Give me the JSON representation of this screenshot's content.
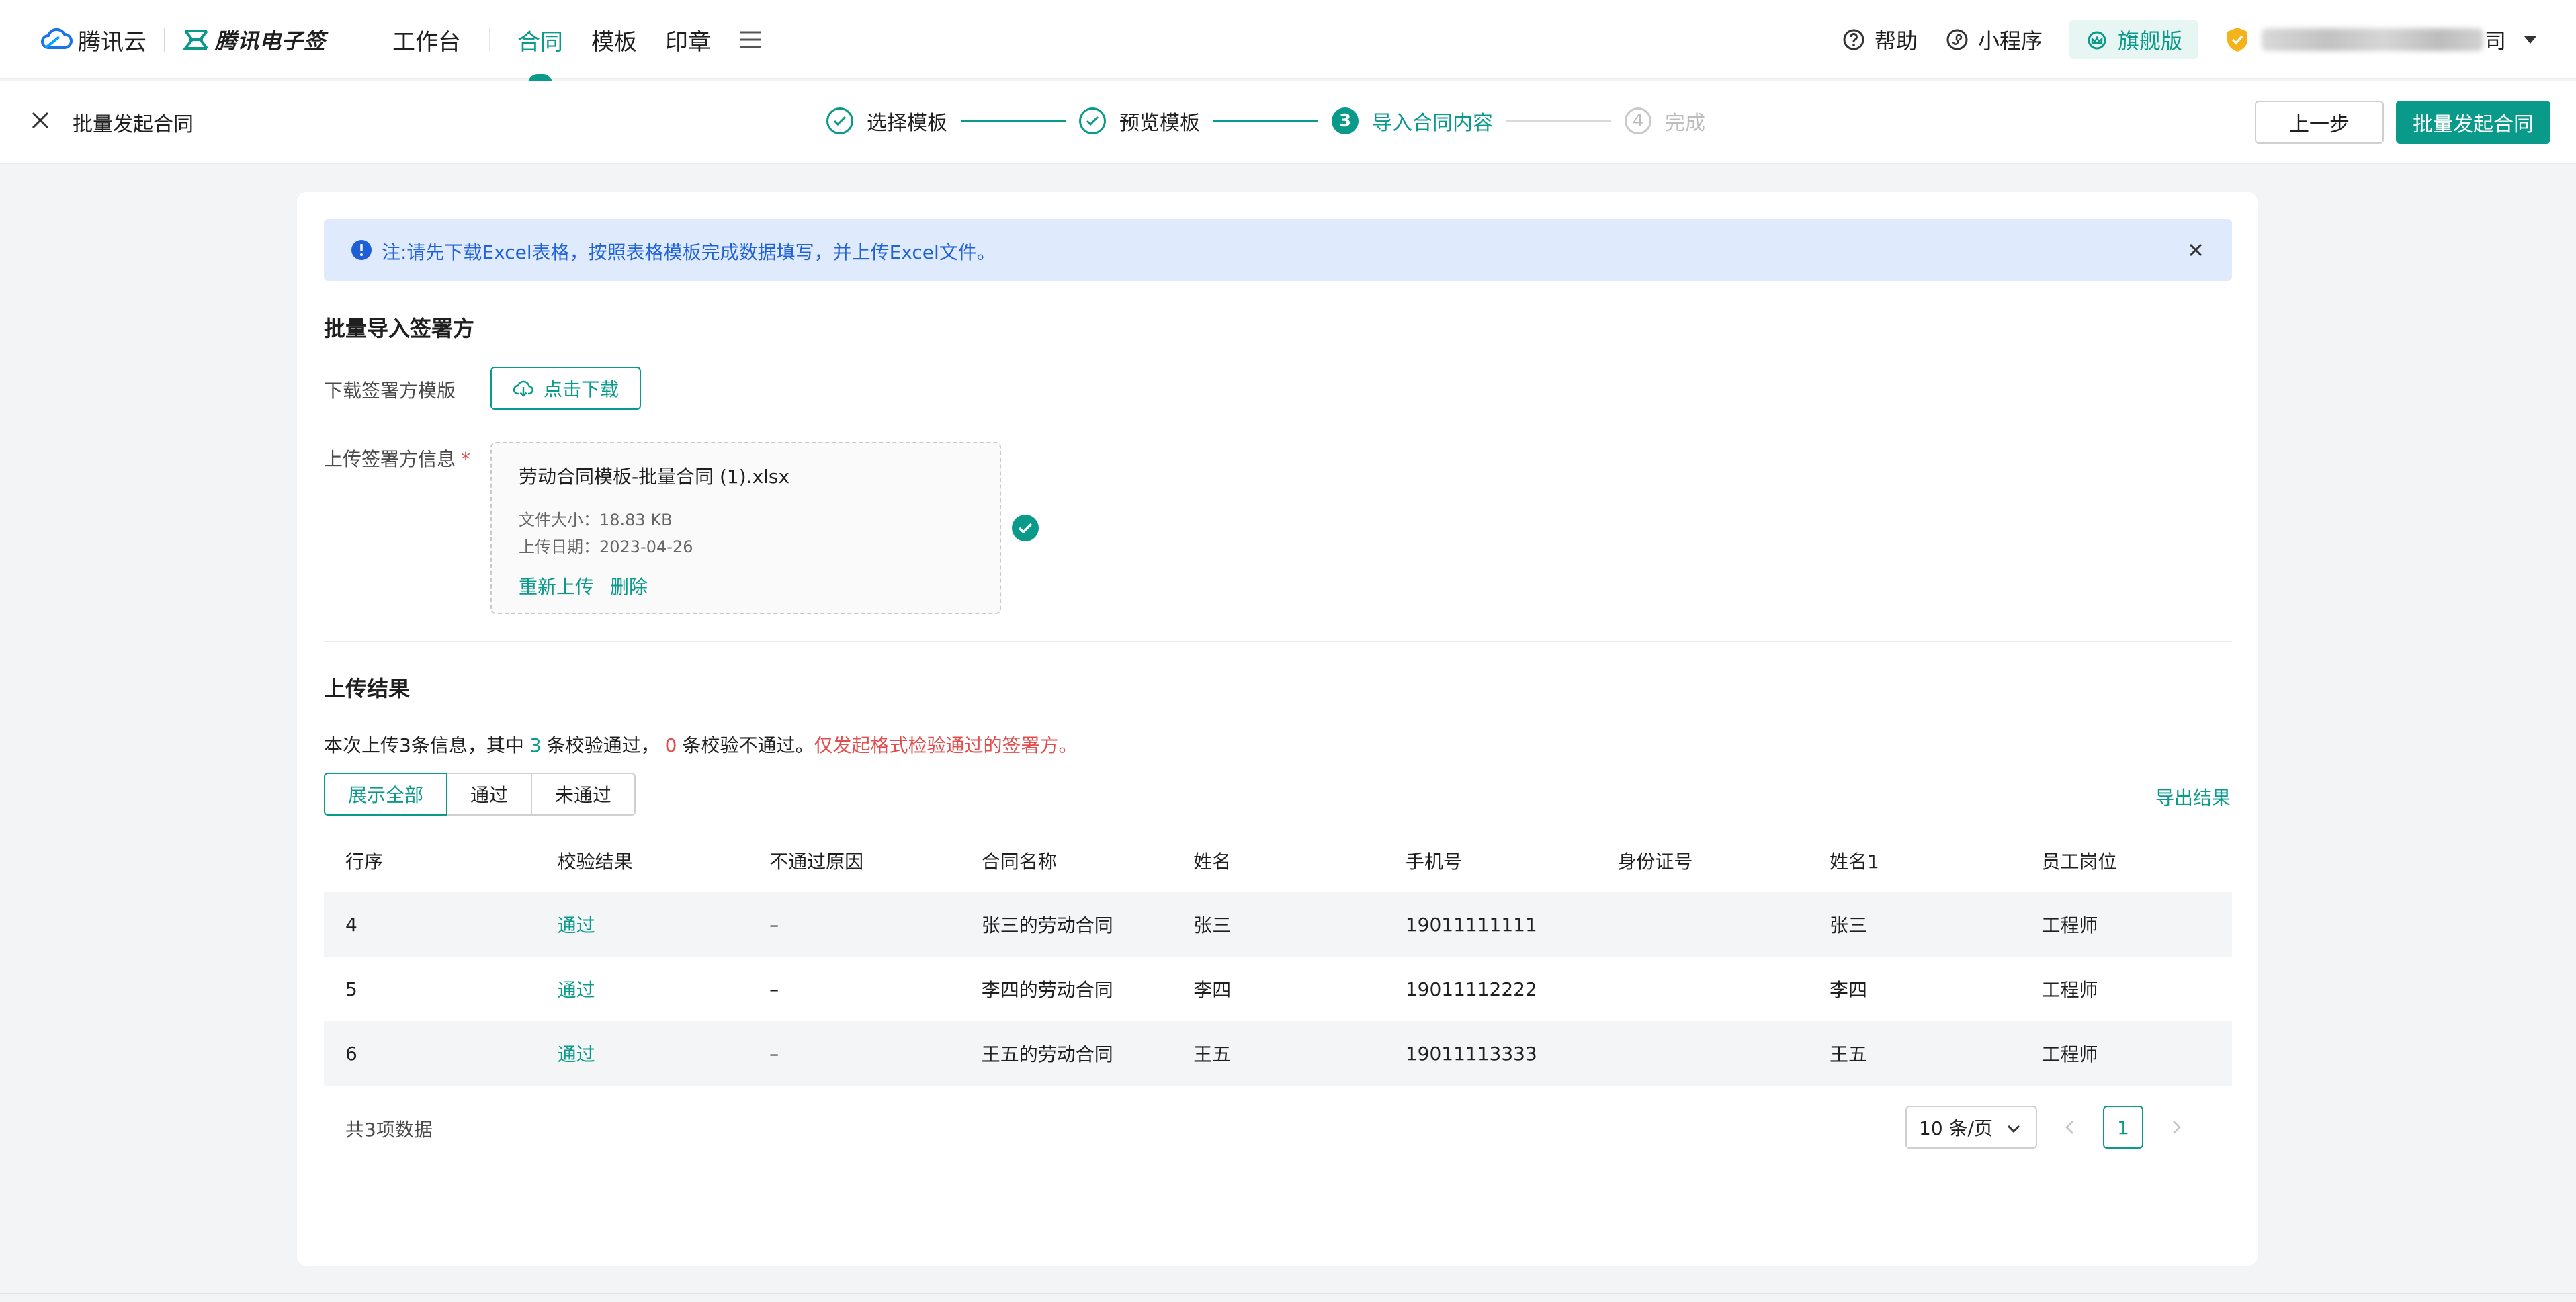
{
  "brand": {
    "cloud_name": "腾讯云",
    "product_name": "腾讯电子签"
  },
  "nav": {
    "items": [
      {
        "label": "工作台",
        "active": false
      },
      {
        "label": "合同",
        "active": true
      },
      {
        "label": "模板",
        "active": false
      },
      {
        "label": "印章",
        "active": false
      }
    ],
    "help": "帮助",
    "mini_program": "小程序",
    "edition": "旗舰版",
    "company_suffix": "司"
  },
  "stepbar": {
    "page_title": "批量发起合同",
    "steps": [
      {
        "label": "选择模板",
        "status": "done",
        "num": "1"
      },
      {
        "label": "预览模板",
        "status": "done",
        "num": "2"
      },
      {
        "label": "导入合同内容",
        "status": "current",
        "num": "3"
      },
      {
        "label": "完成",
        "status": "todo",
        "num": "4"
      }
    ],
    "prev_label": "上一步",
    "submit_label": "批量发起合同"
  },
  "notice": {
    "text": "注:请先下载Excel表格，按照表格模板完成数据填写，并上传Excel文件。"
  },
  "import_section": {
    "title": "批量导入签署方",
    "download_label": "下载签署方模版",
    "download_button": "点击下载",
    "upload_label": "上传签署方信息",
    "required_mark": "*",
    "file": {
      "name": "劳动合同模板-批量合同 (1).xlsx",
      "size": "文件大小：18.83 KB",
      "date": "上传日期：2023-04-26",
      "reupload": "重新上传",
      "delete": "删除"
    }
  },
  "result": {
    "title": "上传结果",
    "summary_prefix": "本次上传3条信息，其中",
    "pass_count": "3",
    "summary_mid": "条校验通过，",
    "fail_count": "0",
    "summary_suffix": "条校验不通过。",
    "warning": "仅发起格式检验通过的签署方。",
    "filters": [
      {
        "label": "展示全部",
        "active": true
      },
      {
        "label": "通过",
        "active": false
      },
      {
        "label": "未通过",
        "active": false
      }
    ],
    "export": "导出结果",
    "columns": [
      "行序",
      "校验结果",
      "不通过原因",
      "合同名称",
      "姓名",
      "手机号",
      "身份证号",
      "姓名1",
      "员工岗位"
    ],
    "rows": [
      [
        "4",
        "通过",
        "–",
        "张三的劳动合同",
        "张三",
        "19011111111",
        "",
        "张三",
        "工程师"
      ],
      [
        "5",
        "通过",
        "–",
        "李四的劳动合同",
        "李四",
        "19011112222",
        "",
        "李四",
        "工程师"
      ],
      [
        "6",
        "通过",
        "–",
        "王五的劳动合同",
        "王五",
        "19011113333",
        "",
        "王五",
        "工程师"
      ]
    ],
    "total": "共3项数据",
    "page_size": "10 条/页",
    "current_page": "1"
  },
  "colors": {
    "accent": "#0a9a8a",
    "notice_bg": "#dfeafd",
    "notice_text": "#2063d9",
    "error": "#e34d4d"
  }
}
